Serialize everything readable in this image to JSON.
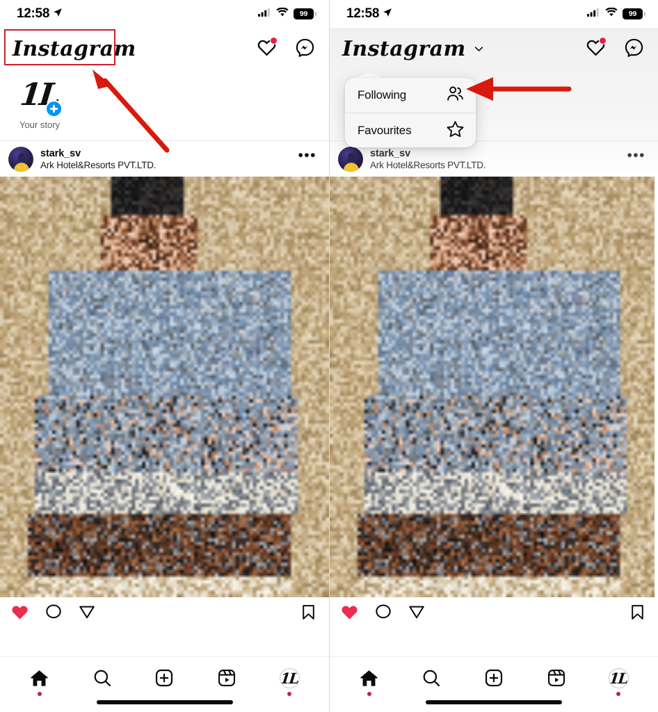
{
  "meta": {
    "accent_red": "#cc1f2a",
    "annotation_red": "#d81a0d",
    "instagram_blue": "#0095f6",
    "like_red": "#ed2b4e",
    "panels": 2
  },
  "status_bar": {
    "time": "12:58",
    "location_icon": "location-arrow-icon",
    "cellular_icon": "cellular-bars-icon",
    "wifi_icon": "wifi-icon",
    "battery_level": "99"
  },
  "header": {
    "logo_text": "Instagram",
    "chevron_icon": "chevron-down-icon",
    "activity_icon": "heart-icon",
    "activity_has_badge": true,
    "messenger_icon": "messenger-icon"
  },
  "stories": {
    "your_story_label": "Your story",
    "add_icon": "plus-icon",
    "avatar_mark": "1L"
  },
  "post": {
    "username": "stark_sv",
    "subtitle": "Ark Hotel&Resorts PVT.LTD.",
    "more_icon": "ellipsis-icon",
    "more_label": "•••",
    "like_icon": "heart-filled-icon",
    "comment_icon": "comment-icon",
    "share_icon": "share-icon",
    "save_icon": "bookmark-icon",
    "media_description": "pixelated-photo"
  },
  "dropdown": {
    "visible_on": "right-panel",
    "items": [
      {
        "label": "Following",
        "icon": "people-icon"
      },
      {
        "label": "Favourites",
        "icon": "star-icon"
      }
    ]
  },
  "tabbar": {
    "items": [
      {
        "name": "home",
        "icon": "home-icon",
        "active": true,
        "dot": true
      },
      {
        "name": "search",
        "icon": "search-icon",
        "active": false,
        "dot": false
      },
      {
        "name": "create",
        "icon": "plus-box-icon",
        "active": false,
        "dot": false
      },
      {
        "name": "reels",
        "icon": "reels-icon",
        "active": false,
        "dot": false
      },
      {
        "name": "profile",
        "icon": "avatar-icon",
        "active": false,
        "dot": true
      }
    ],
    "profile_avatar_mark": "1L"
  },
  "annotations": [
    {
      "type": "box",
      "target": "instagram-logo",
      "panel": "left"
    },
    {
      "type": "arrow",
      "target": "instagram-logo",
      "panel": "left",
      "direction": "up-left"
    },
    {
      "type": "arrow",
      "target": "following-option",
      "panel": "right",
      "direction": "left"
    }
  ]
}
